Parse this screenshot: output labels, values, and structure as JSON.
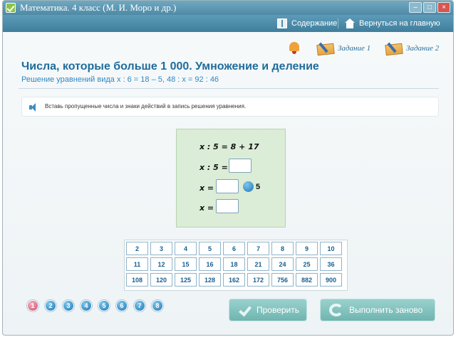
{
  "window": {
    "title": "Математика. 4 класс (М. И. Моро и др.)"
  },
  "navbar": {
    "contents": "Содержание",
    "home": "Вернуться на главную"
  },
  "tasks": {
    "task1": "Задание 1",
    "task2": "Задание 2"
  },
  "lesson": {
    "title": "Числа, которые больше 1 000. Умножение и деление",
    "subtitle": "Решение уравнений вида x : 6 = 18 – 5, 48 : x = 92 : 46"
  },
  "instruction": "Вставь пропущенные числа и знаки действий в запись решения уравнения.",
  "equations": {
    "line1": "x : 5 = 8 + 17",
    "line2": "x : 5 =",
    "line3": "x =",
    "line3_tail": "5",
    "line4": "x ="
  },
  "numbers": [
    [
      "2",
      "3",
      "4",
      "5",
      "6",
      "7",
      "8",
      "9",
      "10"
    ],
    [
      "11",
      "12",
      "15",
      "16",
      "18",
      "21",
      "24",
      "25",
      "36"
    ],
    [
      "108",
      "120",
      "125",
      "128",
      "162",
      "172",
      "756",
      "882",
      "900"
    ]
  ],
  "pages": [
    "1",
    "2",
    "3",
    "4",
    "5",
    "6",
    "7",
    "8"
  ],
  "buttons": {
    "check": "Проверить",
    "redo": "Выполнить заново"
  },
  "colors": {
    "accent": "#1f6c9c",
    "titlebar": "#4f8aa6",
    "work_area": "#dbedd6",
    "button": "#7fbfba"
  }
}
